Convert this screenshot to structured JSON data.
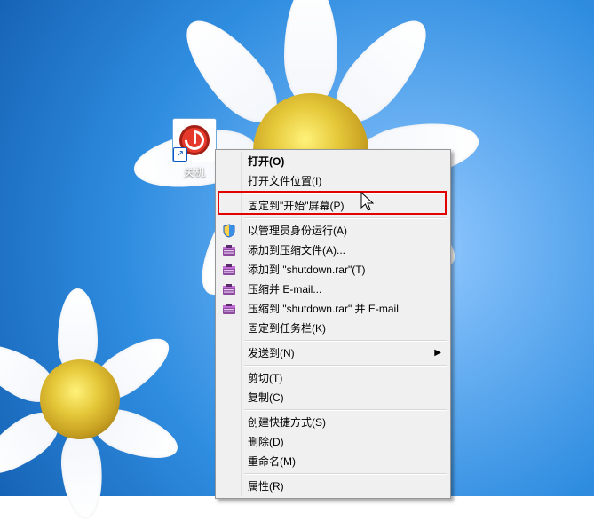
{
  "desktop": {
    "icon_label": "关机",
    "shortcut_arrow": "↗"
  },
  "context_menu": {
    "open": "打开(O)",
    "open_file_location": "打开文件位置(I)",
    "pin_to_start": "固定到\"开始\"屏幕(P)",
    "run_as_admin": "以管理员身份运行(A)",
    "add_to_archive": "添加到压缩文件(A)...",
    "add_to_shutdown_rar": "添加到 \"shutdown.rar\"(T)",
    "compress_and_email": "压缩并 E-mail...",
    "compress_shutdown_and_email": "压缩到 \"shutdown.rar\" 并 E-mail",
    "pin_to_taskbar": "固定到任务栏(K)",
    "send_to": "发送到(N)",
    "cut": "剪切(T)",
    "copy": "复制(C)",
    "create_shortcut": "创建快捷方式(S)",
    "delete": "删除(D)",
    "rename": "重命名(M)",
    "properties": "属性(R)"
  }
}
